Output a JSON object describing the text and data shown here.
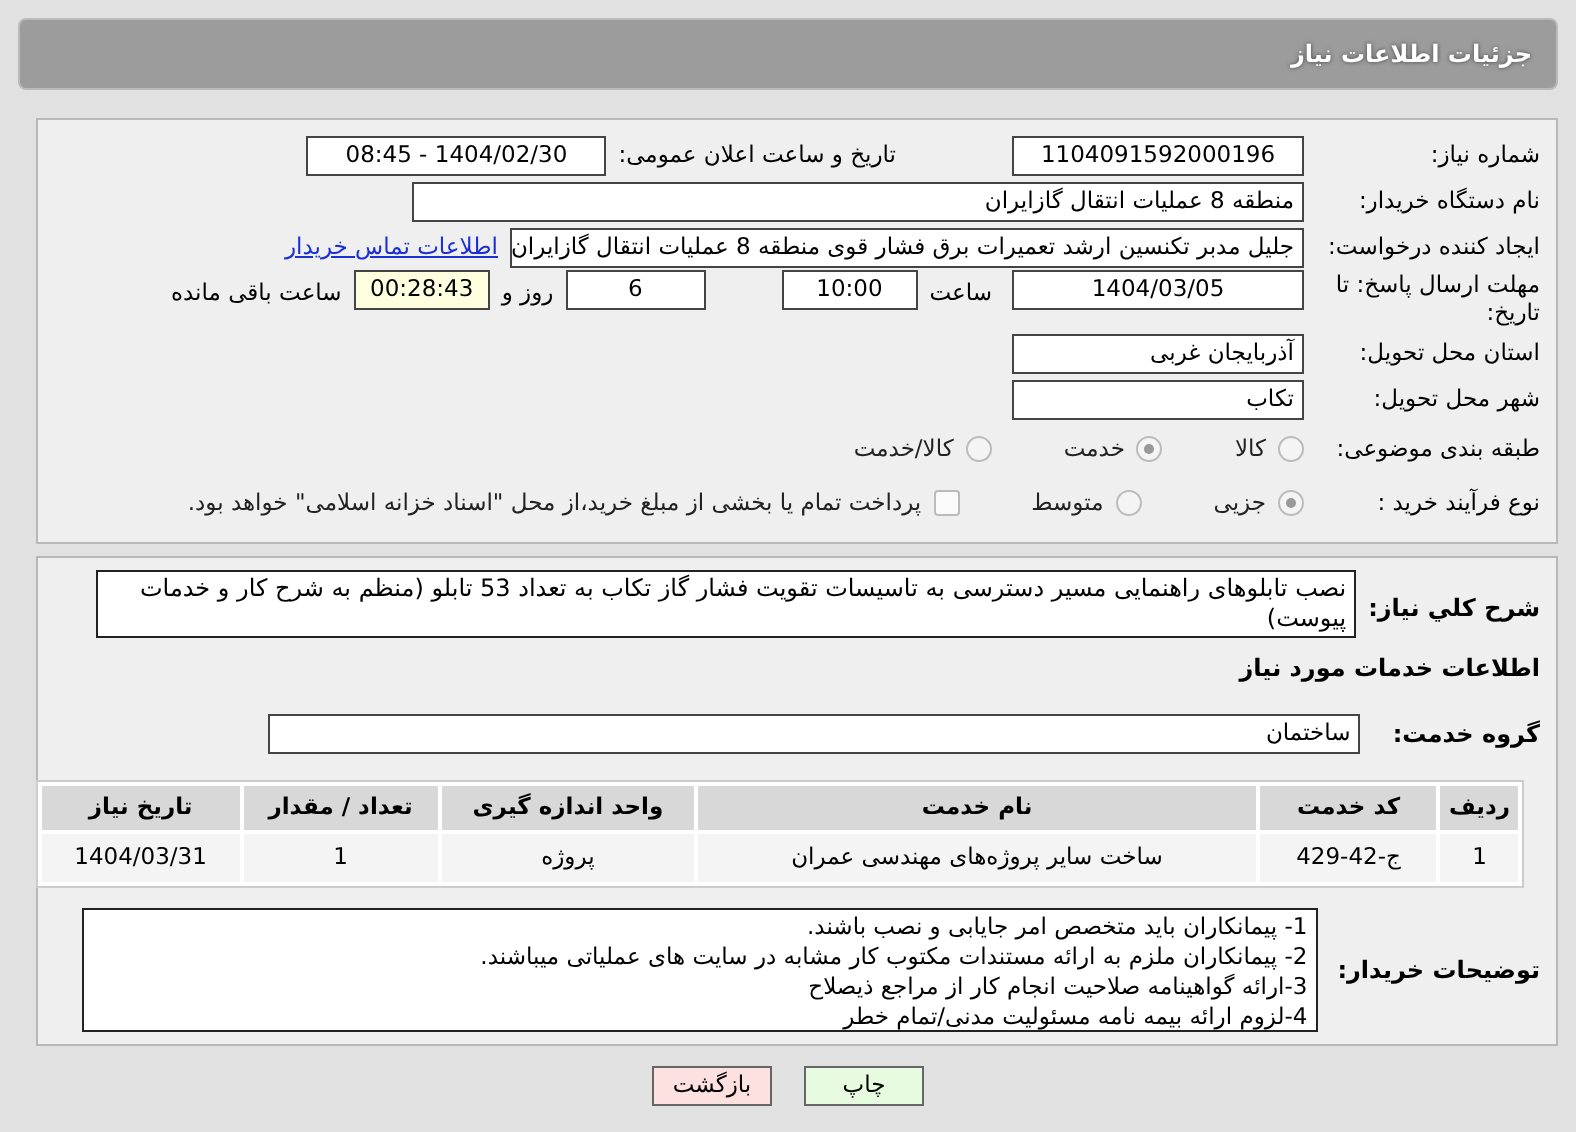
{
  "header": {
    "title": "جزئیات اطلاعات نیاز"
  },
  "need_number": {
    "label": "شماره نیاز:",
    "value": "1104091592000196"
  },
  "announce": {
    "label": "تاریخ و ساعت اعلان عمومی:",
    "value": "1404/02/30 - 08:45"
  },
  "buyer": {
    "label": "نام دستگاه خریدار:",
    "value": "منطقه 8 عملیات انتقال گازایران"
  },
  "creator": {
    "label": "ایجاد کننده درخواست:",
    "value": "جلیل مدبر تکنسین ارشد تعمیرات برق فشار قوی منطقه 8 عملیات انتقال گازایران",
    "link": "اطلاعات تماس خریدار"
  },
  "deadline": {
    "label": "مهلت ارسال پاسخ: تا تاریخ:",
    "date": "1404/03/05",
    "time_label": "ساعت",
    "time": "10:00",
    "days": "6",
    "days_label": "روز و",
    "remaining": "00:28:43",
    "remaining_label": "ساعت باقی مانده"
  },
  "province": {
    "label": "استان محل تحویل:",
    "value": "آذربایجان غربی"
  },
  "city": {
    "label": "شهر محل تحویل:",
    "value": "تکاب"
  },
  "category": {
    "label": "طبقه بندی موضوعی:",
    "options": [
      {
        "label": "کالا",
        "selected": false
      },
      {
        "label": "خدمت",
        "selected": true
      },
      {
        "label": "کالا/خدمت",
        "selected": false
      }
    ]
  },
  "process": {
    "label": "نوع فرآیند خرید :",
    "options": [
      {
        "label": "جزیی",
        "selected": true
      },
      {
        "label": "متوسط",
        "selected": false
      }
    ],
    "payment": {
      "label": "پرداخت تمام یا بخشی از مبلغ خرید،از محل \"اسناد خزانه اسلامی\" خواهد بود.",
      "checked": false
    }
  },
  "description": {
    "label": "شرح كلي نياز:",
    "value": "نصب تابلوهای راهنمایی مسیر دسترسی به تاسیسات تقویت فشار گاز تکاب به تعداد 53 تابلو (منظم به شرح کار و خدمات پیوست)"
  },
  "services_title": "اطلاعات خدمات مورد نیاز",
  "service_group": {
    "label": "گروه خدمت:",
    "value": "ساختمان"
  },
  "table": {
    "columns": [
      "ردیف",
      "کد خدمت",
      "نام خدمت",
      "واحد اندازه گیری",
      "تعداد / مقدار",
      "تاریخ نیاز"
    ],
    "rows": [
      [
        "1",
        "ج-42-429",
        "ساخت سایر پروژه‌های مهندسی عمران",
        "پروژه",
        "1",
        "1404/03/31"
      ]
    ]
  },
  "notes": {
    "label": "توضیحات خریدار:",
    "lines": [
      "1- پیمانکاران باید متخصص امر جایابی و نصب باشند.",
      "2- پیمانکاران ملزم به ارائه مستندات مکتوب کار مشابه در سایت های عملیاتی میباشند.",
      "3-ارائه گواهینامه صلاحیت انجام کار از مراجع ذیصلاح",
      "4-لزوم ارائه بیمه نامه مسئولیت مدنی/تمام خطر"
    ]
  },
  "buttons": [
    {
      "label": "چاپ",
      "kind": "print"
    },
    {
      "label": "بازگشت",
      "kind": "back"
    }
  ]
}
